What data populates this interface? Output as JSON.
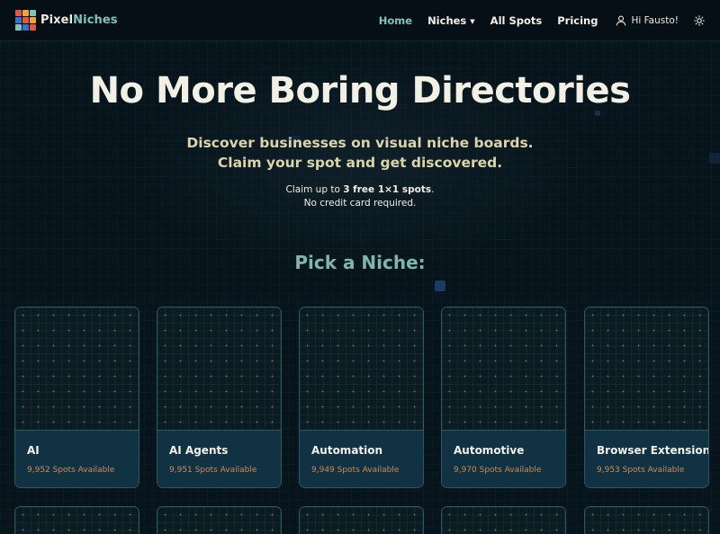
{
  "brand": {
    "name_part1": "Pixel",
    "name_part2": "Niches",
    "logo_colors": [
      "#e0593f",
      "#f2a33a",
      "#7fc3b9",
      "#3b6fd1",
      "#e0593f",
      "#f2a33a",
      "#7fc3b9",
      "#3b6fd1",
      "#e0593f"
    ]
  },
  "nav": {
    "home": "Home",
    "niches": "Niches",
    "all_spots": "All Spots",
    "pricing": "Pricing",
    "greeting": "Hi Fausto!",
    "icons": {
      "user": "user-icon",
      "theme": "sun-icon",
      "dropdown": "caret-down-icon"
    }
  },
  "hero": {
    "title": "No More Boring Directories",
    "subtitle_line1": "Discover businesses on visual niche boards.",
    "subtitle_line2": "Claim your spot and get discovered.",
    "note_prefix": "Claim up to ",
    "note_bold": "3 free 1×1 spots",
    "note_suffix": ".",
    "note_line2": "No credit card required."
  },
  "section": {
    "title": "Pick a Niche:"
  },
  "niches": [
    {
      "name": "AI",
      "spots": "9,952 Spots Available"
    },
    {
      "name": "AI Agents",
      "spots": "9,951 Spots Available"
    },
    {
      "name": "Automation",
      "spots": "9,949 Spots Available"
    },
    {
      "name": "Automotive",
      "spots": "9,970 Spots Available"
    },
    {
      "name": "Browser Extensions",
      "spots": "9,953 Spots Available"
    }
  ],
  "colors": {
    "accent": "#7fc3b9",
    "background": "#07141c",
    "card_border": "#2b5863",
    "card_footer": "#113242",
    "spots_text": "#c98a57",
    "subtitle": "#dcd5a9"
  }
}
